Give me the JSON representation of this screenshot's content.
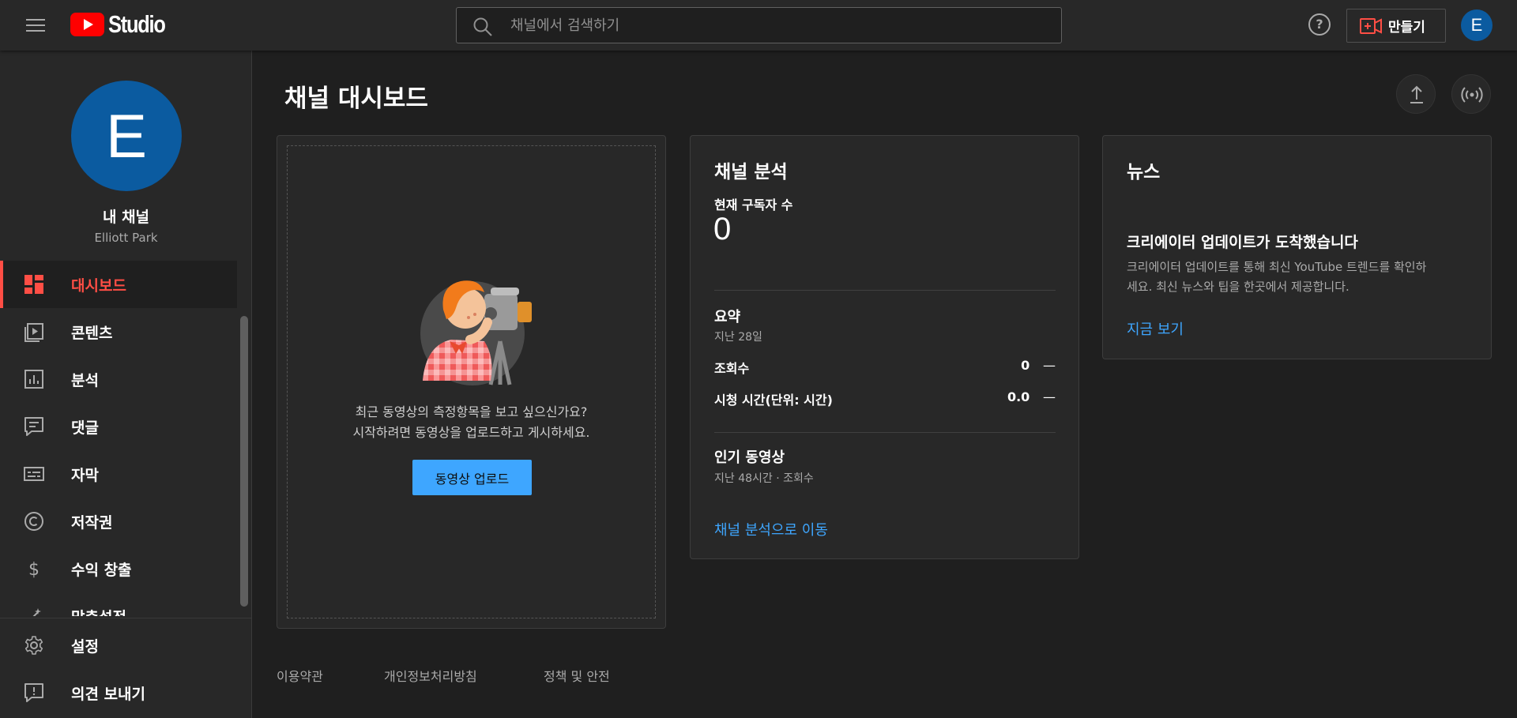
{
  "header": {
    "logo_text": "Studio",
    "search_placeholder": "채널에서 검색하기",
    "help_symbol": "?",
    "create_label": "만들기",
    "avatar_letter": "E"
  },
  "sidebar": {
    "avatar_letter": "E",
    "channel_label": "내 채널",
    "channel_name": "Elliott Park",
    "items": [
      {
        "label": "대시보드",
        "icon": "dashboard-icon",
        "active": true
      },
      {
        "label": "콘텐츠",
        "icon": "content-icon"
      },
      {
        "label": "분석",
        "icon": "analytics-icon"
      },
      {
        "label": "댓글",
        "icon": "comments-icon"
      },
      {
        "label": "자막",
        "icon": "subtitles-icon"
      },
      {
        "label": "저작권",
        "icon": "copyright-icon"
      },
      {
        "label": "수익 창출",
        "icon": "monetization-icon"
      },
      {
        "label": "맞춤설정",
        "icon": "customization-icon"
      }
    ],
    "bottom": [
      {
        "label": "설정",
        "icon": "settings-icon"
      },
      {
        "label": "의견 보내기",
        "icon": "feedback-icon"
      }
    ]
  },
  "main": {
    "title": "채널 대시보드",
    "upload_card": {
      "line1": "최근 동영상의 측정항목을 보고 싶으신가요?",
      "line2": "시작하려면 동영상을 업로드하고 게시하세요.",
      "button": "동영상 업로드"
    },
    "analytics": {
      "title": "채널 분석",
      "subs_label": "현재 구독자 수",
      "subs_value": "0",
      "summary_title": "요약",
      "summary_period": "지난 28일",
      "metrics": [
        {
          "label": "조회수",
          "value": "0",
          "trend": "—"
        },
        {
          "label": "시청 시간(단위: 시간)",
          "value": "0.0",
          "trend": "—"
        }
      ],
      "top_videos_title": "인기 동영상",
      "top_videos_sub": "지난 48시간 · 조회수",
      "link": "채널 분석으로 이동"
    },
    "news": {
      "title": "뉴스",
      "headline": "크리에이터 업데이트가 도착했습니다",
      "body_line1": "크리에이터 업데이트를 통해 최신 YouTube 트렌드를 확인하",
      "body_line2": "세요. 최신 뉴스와 팁을 한곳에서 제공합니다.",
      "link": "지금 보기"
    }
  },
  "footer": {
    "links": [
      "이용약관",
      "개인정보처리방침",
      "정책 및 안전"
    ]
  },
  "colors": {
    "accent_red": "#ff4e45",
    "link_blue": "#3ea6ff",
    "avatar_blue": "#0b5ba0"
  }
}
